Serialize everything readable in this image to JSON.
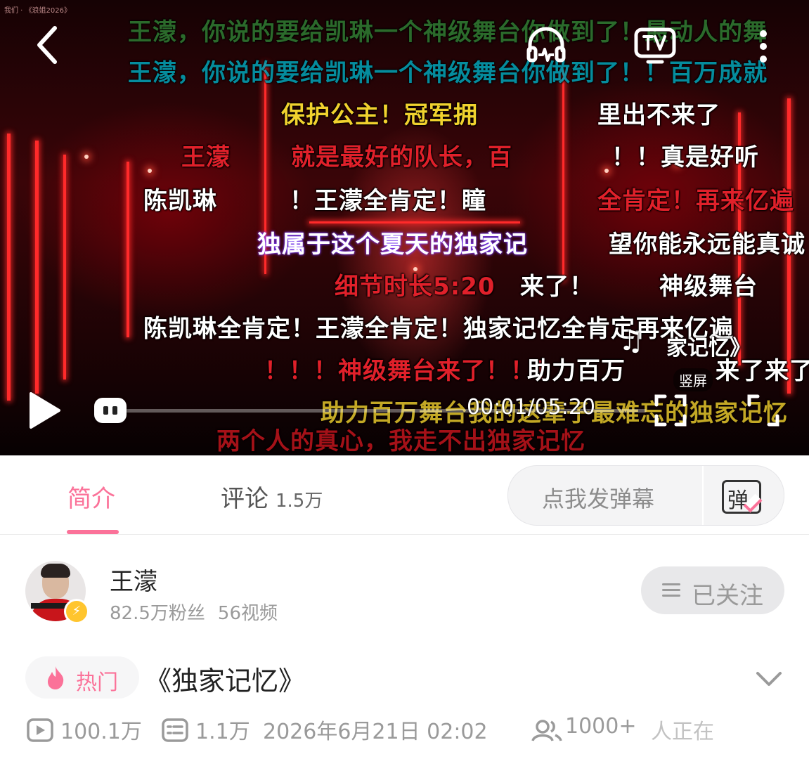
{
  "player": {
    "source_label": "我们 · 《浪姐2026》",
    "danmaku": [
      {
        "text": "王濛，你说的要给凯琳一个神级舞台你做到了！最动人的舞",
        "color": "#2e7d32"
      },
      {
        "text": "王濛，你说的要给凯琳一个神级舞台你做到了！！百万成就",
        "color": "#00a4b8"
      },
      {
        "text": "保护公主！冠军拥",
        "color": "#f1d22e"
      },
      {
        "text": "里出不来了",
        "color": "#ffffff"
      },
      {
        "text": "王濛",
        "color": "#e0202a"
      },
      {
        "text": "就是最好的队长，百",
        "color": "#e0202a"
      },
      {
        "text": "！！真是好听",
        "color": "#ffffff"
      },
      {
        "text": "陈凯琳",
        "color": "#ffffff"
      },
      {
        "text": "！王濛全肯定！瞳",
        "color": "#ffffff"
      },
      {
        "text": "全肯定！再来亿遍",
        "color": "#e0202a"
      },
      {
        "text": "独属于这个夏天的独家记",
        "color": "#ffffff"
      },
      {
        "text": "望你能永远能真诚",
        "color": "#ffffff"
      },
      {
        "text": "细节时长5:20",
        "color": "#e0202a"
      },
      {
        "text": "来了！",
        "color": "#ffffff"
      },
      {
        "text": "神级舞台",
        "color": "#ffffff"
      },
      {
        "text": "陈凯琳全肯定！王濛全肯定！独家记忆全肯定再来亿遍",
        "color": "#ffffff"
      },
      {
        "text": "！！！神级舞台来了！！！",
        "color": "#e0202a"
      },
      {
        "text": "助力百万",
        "color": "#ffffff"
      },
      {
        "text": "来了来了",
        "color": "#ffffff"
      },
      {
        "text": "助力百万舞台我的这辈子最难忘的独家记忆",
        "color": "#f1d22e"
      },
      {
        "text": "两个人的真心，我走不出独家记忆",
        "color": "#c0141c"
      }
    ],
    "song_label": "家记忆》",
    "vertical_label": "竖屏",
    "time": "00:01/05:20",
    "progress": 0.003,
    "accent": "#fb7299"
  },
  "tabs": {
    "intro": "简介",
    "comments": "评论",
    "comments_count": "1.5万",
    "danmaku_placeholder": "点我发弹幕",
    "danmaku_glyph": "弹"
  },
  "uploader": {
    "name": "王濛",
    "fans": "82.5万粉丝",
    "videos": "56视频",
    "follow_label": "已关注"
  },
  "video": {
    "hot_label": "热门",
    "title": "《独家记忆》",
    "views": "100.1万",
    "danmaku_count": "1.1万",
    "date": "2026年6月21日 02:02",
    "watching": "1000+",
    "watching_suffix": "人正在"
  }
}
